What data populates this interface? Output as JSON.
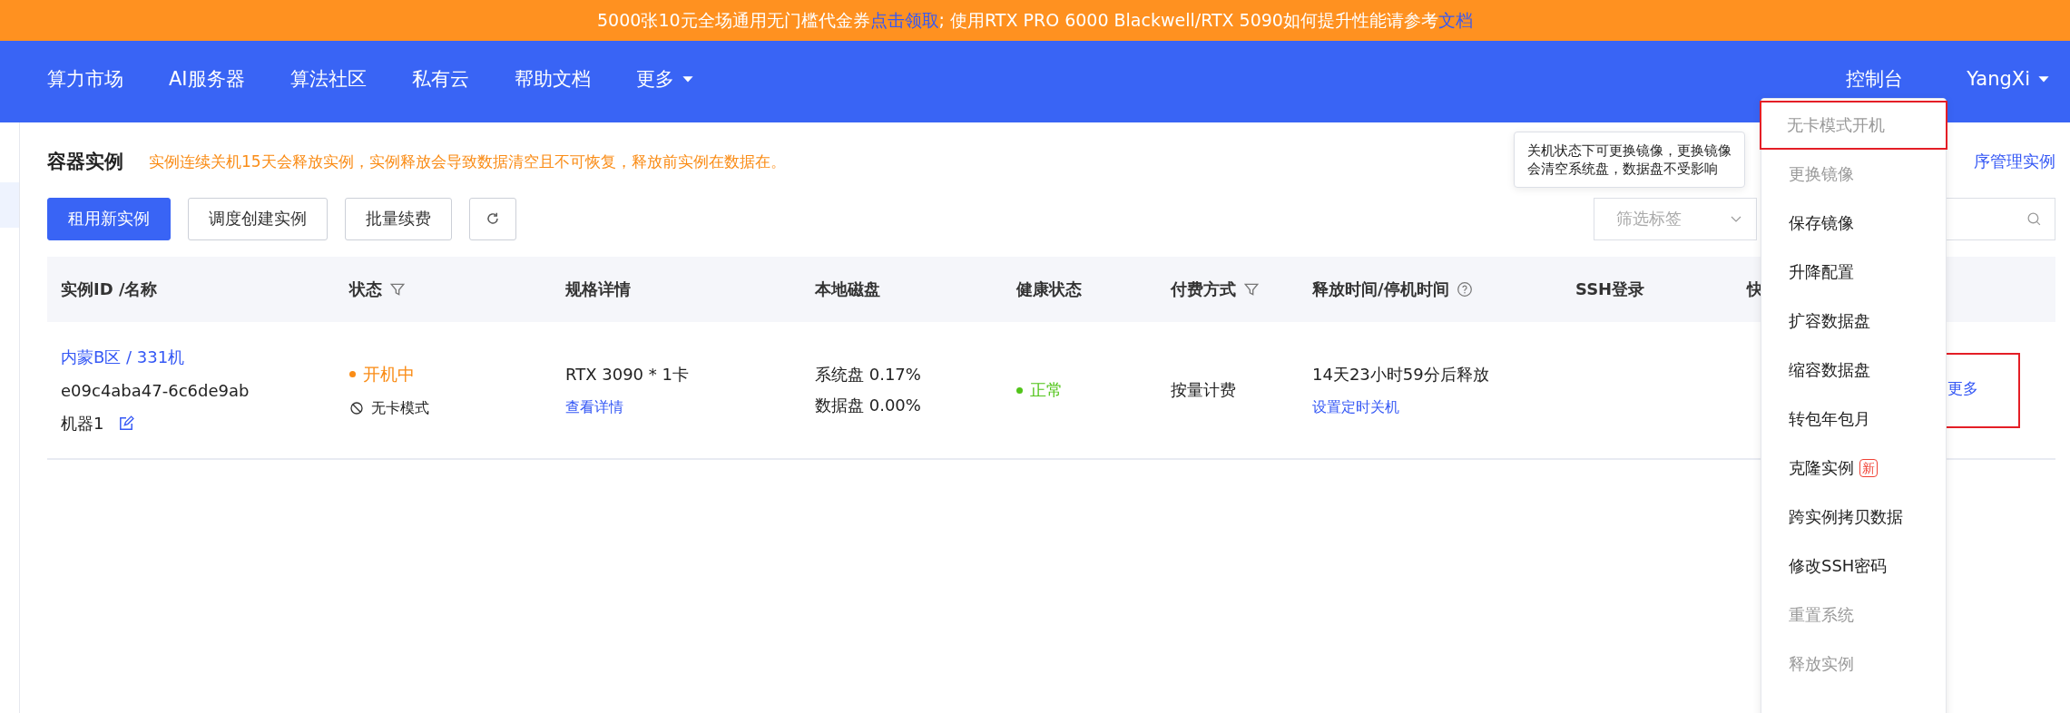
{
  "banner": {
    "parts": [
      {
        "text": "5000张10元全场通用无门槛代金券",
        "kind": "text"
      },
      {
        "text": "点击领取",
        "kind": "link"
      },
      {
        "text": "; 使用RTX PRO 6000 Blackwell/RTX 5090如何提升性能请参考",
        "kind": "text"
      },
      {
        "text": "文档",
        "kind": "link"
      }
    ]
  },
  "nav": {
    "items": [
      {
        "label": "算力市场",
        "dropdown": false
      },
      {
        "label": "AI服务器",
        "dropdown": false
      },
      {
        "label": "算法社区",
        "dropdown": false
      },
      {
        "label": "私有云",
        "dropdown": false
      },
      {
        "label": "帮助文档",
        "dropdown": false
      },
      {
        "label": "更多",
        "dropdown": true
      }
    ],
    "console": "控制台",
    "user": "YangXi"
  },
  "page": {
    "title": "容器实例",
    "notice": "实例连续关机15天会释放实例，实例释放会导致数据清空且不可恢复，释放前实例在数据在。",
    "link": "序管理实例"
  },
  "toolbar": {
    "buttons": [
      {
        "label": "租用新实例",
        "primary": true
      },
      {
        "label": "调度创建实例",
        "primary": false
      },
      {
        "label": "批量续费",
        "primary": false
      }
    ],
    "tag_filter": {
      "placeholder": "筛选标签"
    }
  },
  "table": {
    "columns": [
      {
        "label": "实例ID /名称",
        "kind": "plain"
      },
      {
        "label": "状态",
        "kind": "filter"
      },
      {
        "label": "规格详情",
        "kind": "plain"
      },
      {
        "label": "本地磁盘",
        "kind": "plain"
      },
      {
        "label": "健康状态",
        "kind": "plain"
      },
      {
        "label": "付费方式",
        "kind": "filter"
      },
      {
        "label": "释放时间/停机时间",
        "kind": "help"
      },
      {
        "label": "SSH登录",
        "kind": "plain"
      },
      {
        "label": "快",
        "kind": "plain"
      }
    ],
    "rows": [
      {
        "region": "内蒙B区 / 331机",
        "id": "e09c4aba47-6c6de9ab",
        "name": "机器1",
        "status": {
          "text": "开机中",
          "color": "#fa8c16"
        },
        "mode": "无卡模式",
        "spec": "RTX 3090 * 1卡",
        "spec_link": "查看详情",
        "disks": [
          "系统盘 0.17%",
          "数据盘 0.00%"
        ],
        "health": {
          "text": "正常",
          "color": "#52c41a"
        },
        "billing": "按量计费",
        "release": "14天23小时59分后释放",
        "release_link": "设置定时关机",
        "more": "更多",
        "more_highlighted": true
      }
    ]
  },
  "tooltip": {
    "text": "关机状态下可更换镜像，更换镜像会清空系统盘，数据盘不受影响"
  },
  "menu": {
    "items": [
      {
        "label": "无卡模式开机",
        "disabled": true,
        "highlighted": true
      },
      {
        "label": "更换镜像",
        "disabled": true
      },
      {
        "label": "保存镜像",
        "disabled": false
      },
      {
        "label": "升降配置",
        "disabled": false
      },
      {
        "label": "扩容数据盘",
        "disabled": false
      },
      {
        "label": "缩容数据盘",
        "disabled": false
      },
      {
        "label": "转包年包月",
        "disabled": false
      },
      {
        "label": "克隆实例",
        "disabled": false,
        "badge": "新"
      },
      {
        "label": "跨实例拷贝数据",
        "disabled": false
      },
      {
        "label": "修改SSH密码",
        "disabled": false
      },
      {
        "label": "重置系统",
        "disabled": true
      },
      {
        "label": "释放实例",
        "disabled": true
      }
    ]
  }
}
